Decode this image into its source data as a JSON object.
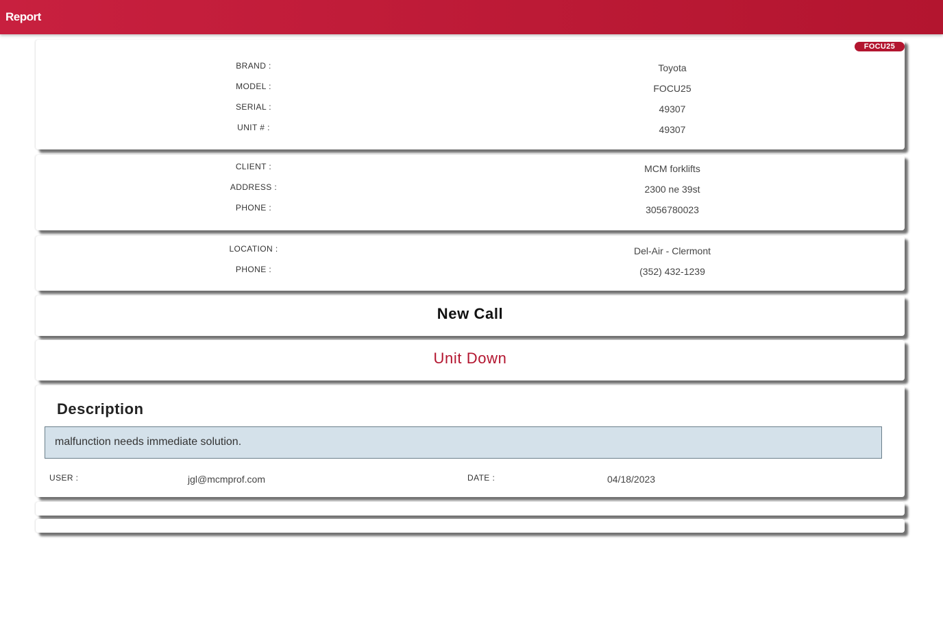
{
  "header": {
    "title": "Report"
  },
  "unit": {
    "badge": "FOCU25",
    "brand_label": "BRAND :",
    "brand": "Toyota",
    "model_label": "MODEL :",
    "model": "FOCU25",
    "serial_label": "SERIAL :",
    "serial": "49307",
    "unit_label": "UNIT # :",
    "unit_no": "49307"
  },
  "client": {
    "client_label": "CLIENT :",
    "client": "MCM forklifts",
    "address_label": "ADDRESS :",
    "address": "2300 ne 39st",
    "phone_label": "PHONE :",
    "phone": "3056780023"
  },
  "location": {
    "location_label": "LOCATION :",
    "location": "Del-Air - Clermont",
    "phone_label": "PHONE :",
    "phone": "(352) 432-1239"
  },
  "call_type": "New Call",
  "status": "Unit Down",
  "description": {
    "heading": "Description",
    "text": "malfunction needs immediate solution.",
    "user_label": "USER :",
    "user": "jgl@mcmprof.com",
    "date_label": "DATE :",
    "date": "04/18/2023"
  },
  "colors": {
    "brand_red": "#b3152f",
    "desc_bg": "#d4e1ea"
  }
}
